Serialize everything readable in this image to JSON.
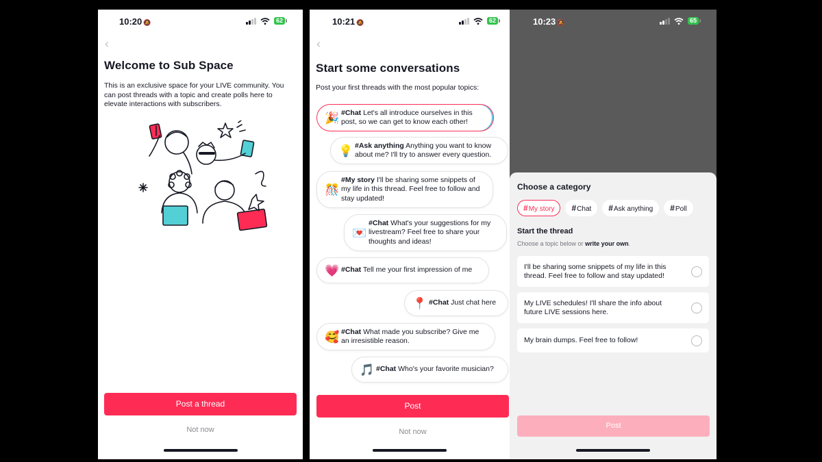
{
  "screen1": {
    "time": "10:20",
    "battery": "62",
    "title": "Welcome to Sub Space",
    "description": "This is an exclusive space for your LIVE community. You can post threads with a topic and create polls here to elevate interactions with subscribers.",
    "primary_button": "Post a thread",
    "secondary_link": "Not now",
    "illustration_icon": "people-celebrating-illustration"
  },
  "screen2": {
    "time": "10:21",
    "battery": "62",
    "title": "Start some conversations",
    "subtitle": "Post your first threads with the most popular topics:",
    "topics": [
      {
        "emoji": "🎉",
        "icon": "party-popper-icon",
        "tag": "#Chat",
        "text": " Let's all introduce ourselves in this post, so we can get to know each other!"
      },
      {
        "emoji": "💡",
        "icon": "light-bulb-icon",
        "tag": "#Ask anything",
        "text": " Anything you want to know about me? I'll try to answer every question."
      },
      {
        "emoji": "🎊",
        "icon": "confetti-icon",
        "tag": "#My story",
        "text": " I'll be sharing some snippets of my life in this thread. Feel free to follow and stay updated!"
      },
      {
        "emoji": "💌",
        "icon": "love-letter-icon",
        "tag": "#Chat",
        "text": " What's your suggestions for my livestream? Feel free to share your thoughts and ideas!"
      },
      {
        "emoji": "💗",
        "icon": "heart-icon",
        "tag": "#Chat",
        "text": " Tell me your first impression of me"
      },
      {
        "emoji": "📍",
        "icon": "pin-icon",
        "tag": "#Chat",
        "text": " Just chat here"
      },
      {
        "emoji": "🥰",
        "icon": "smiling-face-hearts-icon",
        "tag": "#Chat",
        "text": " What made you subscribe? Give me an irresistible reason."
      },
      {
        "emoji": "🎵",
        "icon": "music-note-icon",
        "tag": "#Chat",
        "text": " Who's your favorite musician?"
      }
    ],
    "primary_button": "Post",
    "secondary_link": "Not now"
  },
  "screen3": {
    "time": "10:23",
    "battery": "65",
    "sheet_title": "Choose a category",
    "categories": [
      {
        "label": "My story",
        "selected": true
      },
      {
        "label": "Chat",
        "selected": false
      },
      {
        "label": "Ask anything",
        "selected": false
      },
      {
        "label": "Poll",
        "selected": false
      }
    ],
    "section_title": "Start the thread",
    "hint_prefix": "Choose a topic below or ",
    "hint_bold": "write your own",
    "hint_suffix": ".",
    "options": [
      "I'll be sharing some snippets of my life in this thread. Feel free to follow and stay updated!",
      "My LIVE schedules! I'll share the info about future LIVE sessions here.",
      "My brain dumps. Feel free to follow!"
    ],
    "post_button": "Post"
  },
  "colors": {
    "accent": "#fe2c55",
    "accent_disabled": "#fdaebc",
    "battery": "#33c24d",
    "overlay": "#5a5a5a"
  }
}
